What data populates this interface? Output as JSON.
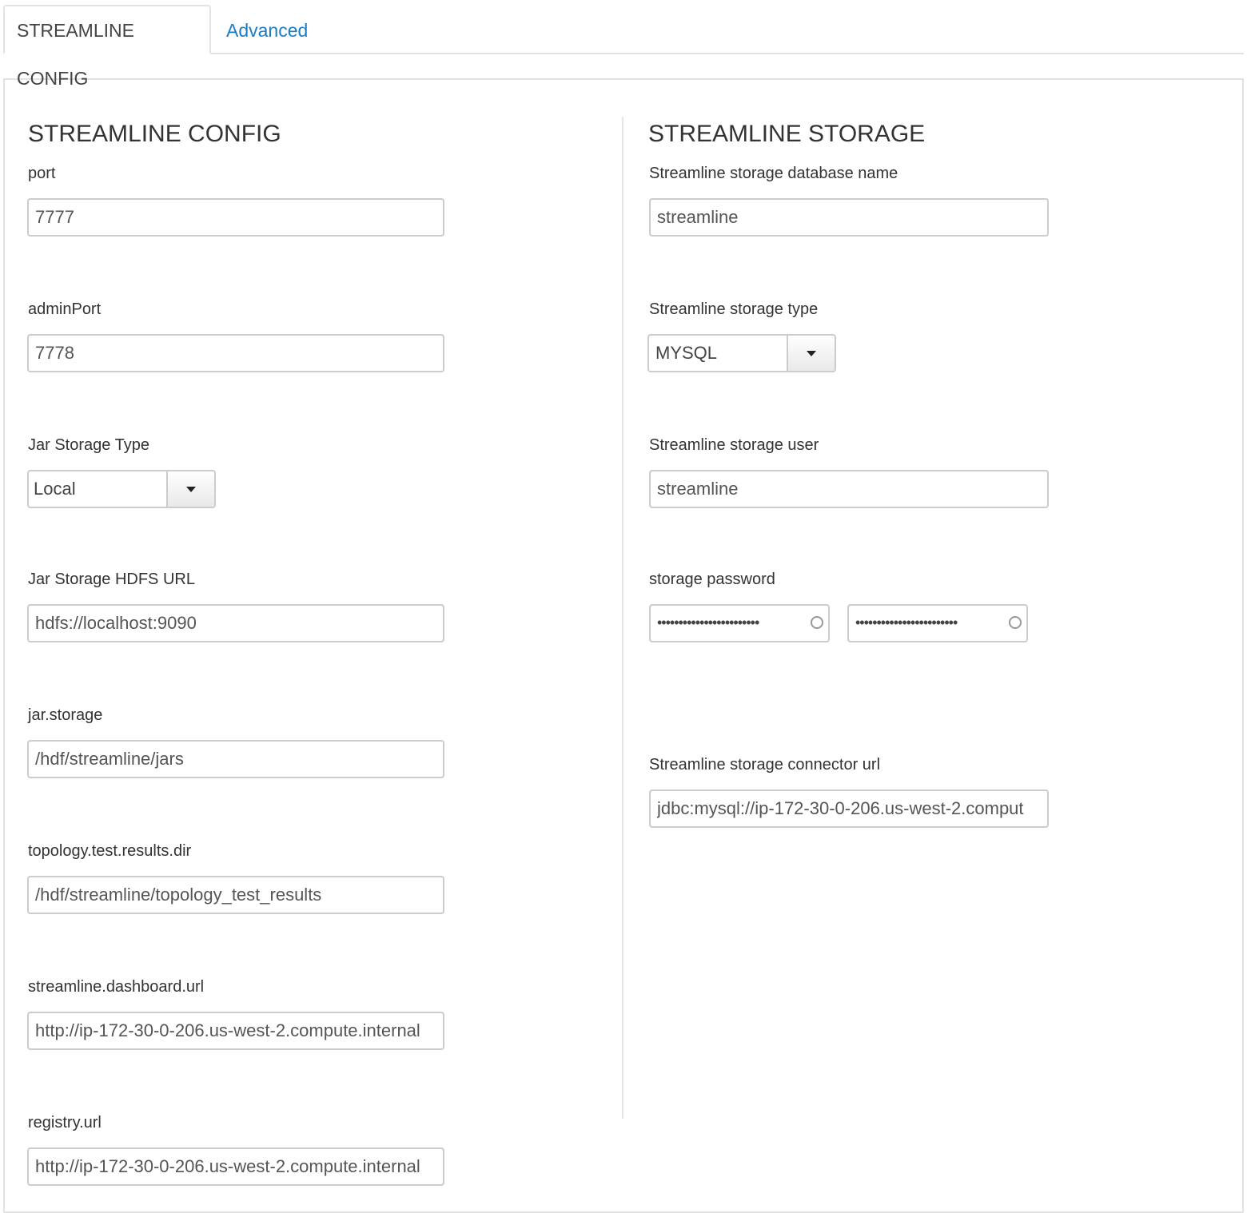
{
  "tabs": {
    "active": "STREAMLINE CONFIG",
    "advanced": "Advanced"
  },
  "left": {
    "title": "STREAMLINE CONFIG",
    "fields": [
      {
        "label": "port",
        "value": "7777"
      },
      {
        "label": "adminPort",
        "value": "7778"
      },
      {
        "label": "Jar Storage Type",
        "value": "Local"
      },
      {
        "label": "Jar Storage HDFS URL",
        "value": "hdfs://localhost:9090"
      },
      {
        "label": "jar.storage",
        "value": "/hdf/streamline/jars"
      },
      {
        "label": "topology.test.results.dir",
        "value": "/hdf/streamline/topology_test_results"
      },
      {
        "label": "streamline.dashboard.url",
        "value": "http://ip-172-30-0-206.us-west-2.compute.internal"
      },
      {
        "label": "registry.url",
        "value": "http://ip-172-30-0-206.us-west-2.compute.internal"
      }
    ]
  },
  "right": {
    "title": "STREAMLINE STORAGE",
    "fields": [
      {
        "label": "Streamline storage database name",
        "value": "streamline"
      },
      {
        "label": "Streamline storage type",
        "value": "MYSQL"
      },
      {
        "label": "Streamline storage user",
        "value": "streamline"
      },
      {
        "label": "storage password",
        "value": "••••••••••••••••••••••••",
        "confirm": "••••••••••••••••••••••••"
      },
      {
        "label": "Streamline storage connector url",
        "value": "jdbc:mysql://ip-172-30-0-206.us-west-2.comput"
      }
    ]
  }
}
